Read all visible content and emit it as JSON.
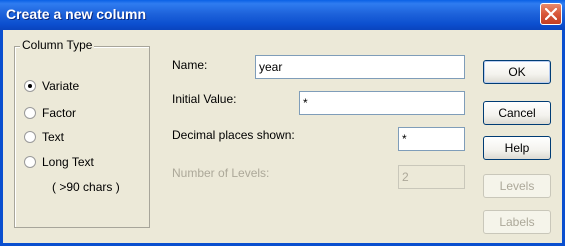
{
  "window": {
    "title": "Create a new column"
  },
  "column_type": {
    "legend": "Column Type",
    "options": [
      {
        "label": "Variate",
        "selected": true
      },
      {
        "label": "Factor",
        "selected": false
      },
      {
        "label": "Text",
        "selected": false
      },
      {
        "label": "Long Text",
        "selected": false
      }
    ],
    "long_text_note": "( >90 chars )"
  },
  "fields": {
    "name": {
      "label": "Name:",
      "value": "year"
    },
    "initial_value": {
      "label": "Initial Value:",
      "value": "*"
    },
    "decimal_places": {
      "label": "Decimal places shown:",
      "value": "*"
    },
    "number_of_levels": {
      "label": "Number of Levels:",
      "value": "2",
      "disabled": true
    }
  },
  "buttons": {
    "ok": "OK",
    "cancel": "Cancel",
    "help": "Help",
    "levels": "Levels",
    "labels": "Labels"
  },
  "colors": {
    "titlebar": "#0a4fcf",
    "dialog_bg": "#ece9d8",
    "close_button": "#d8573a",
    "disabled_text": "#aca899"
  }
}
